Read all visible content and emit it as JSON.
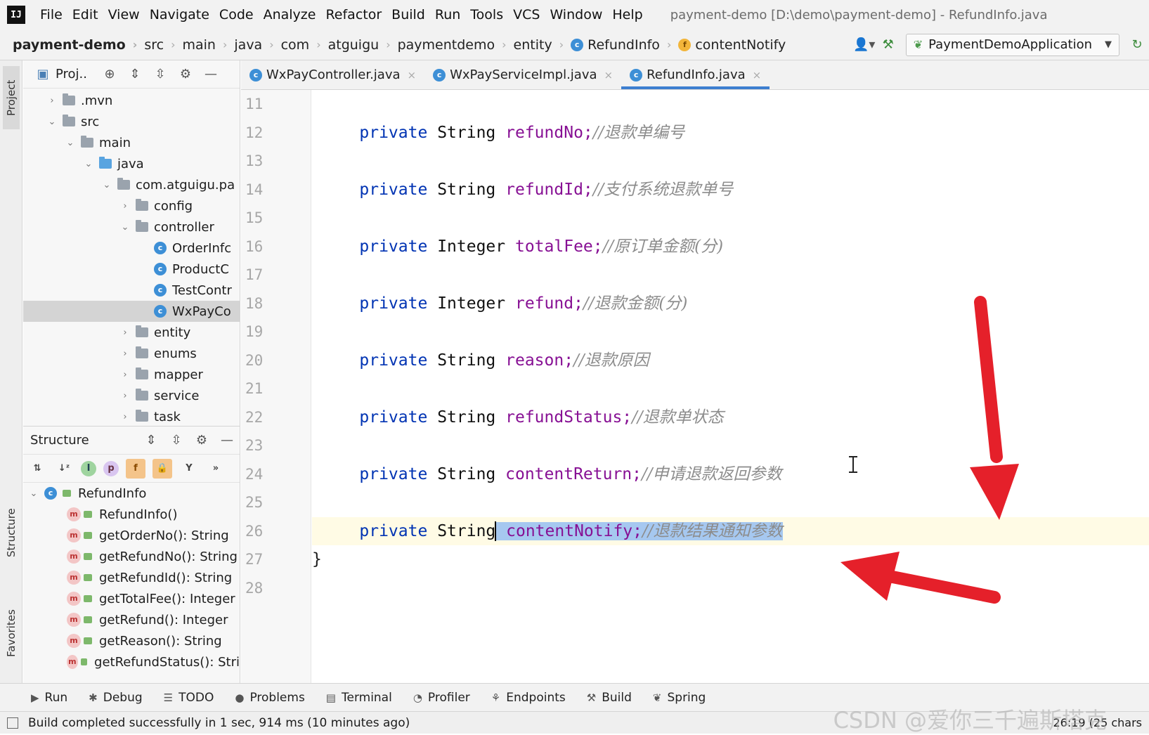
{
  "menu": {
    "items": [
      "File",
      "Edit",
      "View",
      "Navigate",
      "Code",
      "Analyze",
      "Refactor",
      "Build",
      "Run",
      "Tools",
      "VCS",
      "Window",
      "Help"
    ],
    "window_title": "payment-demo [D:\\demo\\payment-demo] - RefundInfo.java"
  },
  "breadcrumb": [
    "payment-demo",
    "src",
    "main",
    "java",
    "com",
    "atguigu",
    "paymentdemo",
    "entity",
    "RefundInfo",
    "contentNotify"
  ],
  "toolbar": {
    "run_config": "PaymentDemoApplication"
  },
  "left_strip": {
    "project": "Project",
    "structure": "Structure",
    "favorites": "Favorites"
  },
  "project_panel": {
    "title": "Proj..",
    "tree": [
      {
        "label": ".mvn",
        "expanded": false
      },
      {
        "label": "src",
        "expanded": true
      },
      {
        "label": "main",
        "expanded": true
      },
      {
        "label": "java",
        "expanded": true
      },
      {
        "label": "com.atguigu.pa",
        "expanded": true
      },
      {
        "label": "config",
        "expanded": false
      },
      {
        "label": "controller",
        "expanded": true
      },
      {
        "label": "OrderInfc"
      },
      {
        "label": "ProductC"
      },
      {
        "label": "TestContr"
      },
      {
        "label": "WxPayCo"
      },
      {
        "label": "entity",
        "expanded": false
      },
      {
        "label": "enums",
        "expanded": false
      },
      {
        "label": "mapper",
        "expanded": false
      },
      {
        "label": "service",
        "expanded": false
      },
      {
        "label": "task",
        "expanded": false
      }
    ]
  },
  "structure_panel": {
    "title": "Structure",
    "root": "RefundInfo",
    "members": [
      "RefundInfo()",
      "getOrderNo(): String",
      "getRefundNo(): String",
      "getRefundId(): String",
      "getTotalFee(): Integer",
      "getRefund(): Integer",
      "getReason(): String",
      "getRefundStatus(): Stri"
    ]
  },
  "editor": {
    "tabs": [
      {
        "label": "WxPayController.java",
        "active": false
      },
      {
        "label": "WxPayServiceImpl.java",
        "active": false
      },
      {
        "label": "RefundInfo.java",
        "active": true
      }
    ],
    "line_numbers": [
      "11",
      "12",
      "13",
      "14",
      "15",
      "16",
      "17",
      "18",
      "19",
      "20",
      "21",
      "22",
      "23",
      "24",
      "25",
      "26",
      "27",
      "28"
    ],
    "lines": [
      {
        "kw": "",
        "type": "",
        "field": "",
        "comment": ""
      },
      {
        "kw": "private",
        "type": "String",
        "field": "refundNo;",
        "comment": "//退款单编号"
      },
      {
        "kw": "",
        "type": "",
        "field": "",
        "comment": ""
      },
      {
        "kw": "private",
        "type": "String",
        "field": "refundId;",
        "comment": "//支付系统退款单号"
      },
      {
        "kw": "",
        "type": "",
        "field": "",
        "comment": ""
      },
      {
        "kw": "private",
        "type": "Integer",
        "field": "totalFee;",
        "comment": "//原订单金额(分)"
      },
      {
        "kw": "",
        "type": "",
        "field": "",
        "comment": ""
      },
      {
        "kw": "private",
        "type": "Integer",
        "field": "refund;",
        "comment": "//退款金额(分)"
      },
      {
        "kw": "",
        "type": "",
        "field": "",
        "comment": ""
      },
      {
        "kw": "private",
        "type": "String",
        "field": "reason;",
        "comment": "//退款原因"
      },
      {
        "kw": "",
        "type": "",
        "field": "",
        "comment": ""
      },
      {
        "kw": "private",
        "type": "String",
        "field": "refundStatus;",
        "comment": "//退款单状态"
      },
      {
        "kw": "",
        "type": "",
        "field": "",
        "comment": ""
      },
      {
        "kw": "private",
        "type": "String",
        "field": "contentReturn;",
        "comment": "//申请退款返回参数"
      },
      {
        "kw": "",
        "type": "",
        "field": "",
        "comment": ""
      },
      {
        "kw": "private",
        "type": "String",
        "field": "contentNotify;",
        "comment": "//退款结果通知参数"
      },
      {
        "brace": "}"
      },
      {
        "kw": "",
        "type": "",
        "field": "",
        "comment": ""
      }
    ]
  },
  "tool_windows": [
    "Run",
    "Debug",
    "TODO",
    "Problems",
    "Terminal",
    "Profiler",
    "Endpoints",
    "Build",
    "Spring"
  ],
  "status": {
    "message": "Build completed successfully in 1 sec, 914 ms (10 minutes ago)",
    "position": "26:19 (25 chars",
    "watermark": "CSDN @爱你三千遍斯塔克"
  },
  "colors": {
    "keyword": "#0033b3",
    "field": "#871094",
    "comment": "#8c8c8c",
    "selection": "#a6c8f0",
    "arrow": "#e5202a"
  }
}
